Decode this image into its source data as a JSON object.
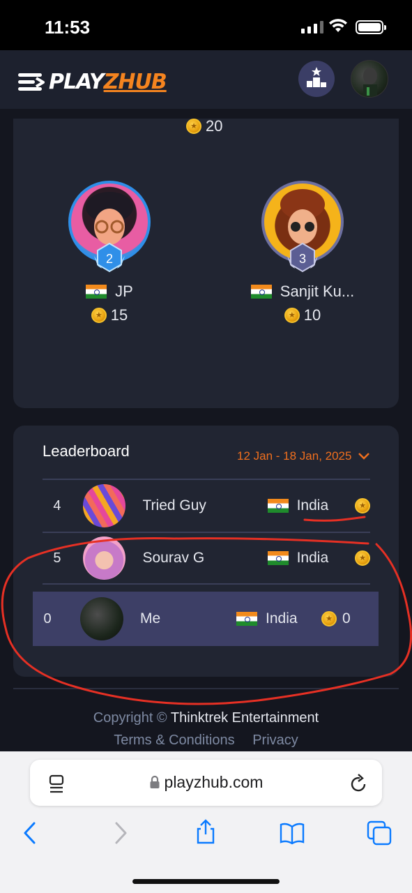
{
  "status_bar": {
    "time": "11:53"
  },
  "header": {
    "logo_text_a": "PLAY",
    "logo_text_b": "ZHUB",
    "logo_icon": "menu-lines-icon",
    "podium_icon": "podium-icon",
    "avatar_icon": "user-avatar"
  },
  "podium": {
    "first": {
      "score": "20"
    },
    "second": {
      "rank": "2",
      "name": "JP",
      "score": "15",
      "flag": "india-flag"
    },
    "third": {
      "rank": "3",
      "name": "Sanjit Ku...",
      "score": "10",
      "flag": "india-flag"
    }
  },
  "leaderboard": {
    "title": "Leaderboard",
    "date_range": "12 Jan - 18 Jan, 2025",
    "rows": [
      {
        "rank": "4",
        "name": "Tried Guy",
        "country": "India"
      },
      {
        "rank": "5",
        "name": "Sourav G",
        "country": "India"
      }
    ],
    "me": {
      "rank": "0",
      "name": "Me",
      "country": "India",
      "score": "0"
    }
  },
  "footer": {
    "copyright": "Copyright ©",
    "company": "Thinktrek Entertainment",
    "terms": "Terms & Conditions",
    "privacy": "Privacy"
  },
  "browser": {
    "url": "playzhub.com"
  },
  "colors": {
    "accent_orange": "#f06f1e",
    "card_bg": "#212532",
    "highlight_row": "#3d3f66",
    "annotation_red": "#e63024"
  }
}
